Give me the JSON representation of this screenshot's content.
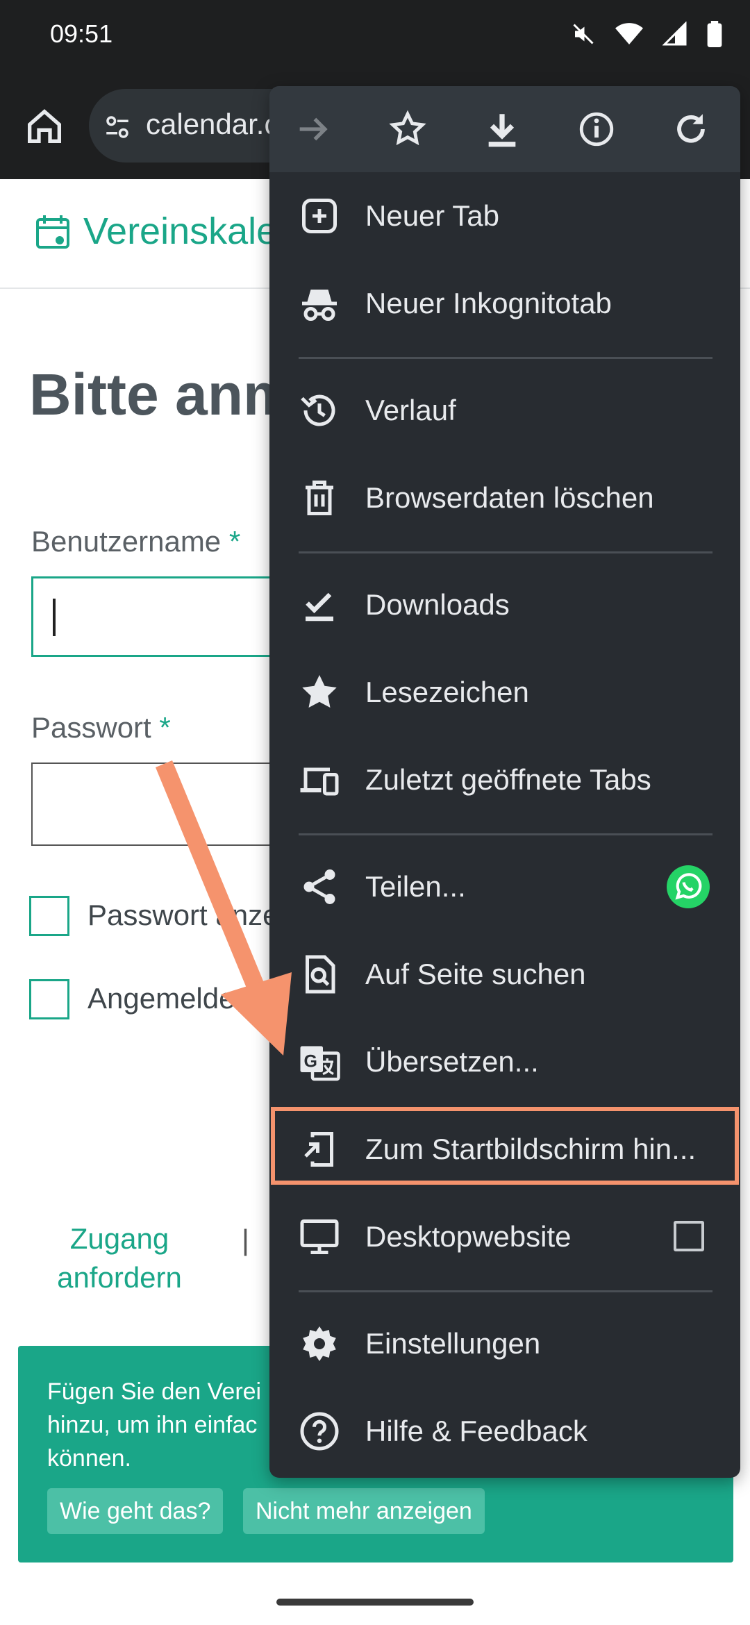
{
  "status": {
    "time": "09:51"
  },
  "browser": {
    "url": "calendar.c"
  },
  "page": {
    "title": "Vereinskale",
    "heading": "Bitte anm",
    "username_label": "Benutzername",
    "password_label": "Passwort",
    "required_mark": "*",
    "show_password_label": "Passwort anze",
    "stay_logged_in_label": "Angemelde",
    "request_access_line1": "Zugang",
    "request_access_line2": "anfordern",
    "link_separator": "|"
  },
  "banner": {
    "text": "Fügen Sie den Verei hinzu, um ihn einfac können.",
    "how_button": "Wie geht das?",
    "dismiss_button": "Nicht mehr anzeigen"
  },
  "menu": {
    "items": [
      {
        "label": "Neuer Tab",
        "icon": "new-tab-icon"
      },
      {
        "label": "Neuer Inkognitotab",
        "icon": "incognito-icon"
      },
      {
        "label": "Verlauf",
        "icon": "history-icon"
      },
      {
        "label": "Browserdaten löschen",
        "icon": "trash-icon"
      },
      {
        "label": "Downloads",
        "icon": "downloads-icon"
      },
      {
        "label": "Lesezeichen",
        "icon": "star-filled-icon"
      },
      {
        "label": "Zuletzt geöffnete Tabs",
        "icon": "devices-icon"
      },
      {
        "label": "Teilen...",
        "icon": "share-icon"
      },
      {
        "label": "Auf Seite suchen",
        "icon": "find-in-page-icon"
      },
      {
        "label": "Übersetzen...",
        "icon": "translate-icon"
      },
      {
        "label": "Zum Startbildschirm hin...",
        "icon": "add-to-home-icon"
      },
      {
        "label": "Desktopwebsite",
        "icon": "desktop-icon"
      },
      {
        "label": "Einstellungen",
        "icon": "gear-icon"
      },
      {
        "label": "Hilfe & Feedback",
        "icon": "help-icon"
      }
    ],
    "desktop_site_checked": false,
    "highlighted_item": "Zum Startbildschirm hin..."
  },
  "colors": {
    "accent": "#1aa688",
    "menu_bg": "#282c31",
    "highlight": "#f5936d",
    "whatsapp": "#25d366"
  }
}
